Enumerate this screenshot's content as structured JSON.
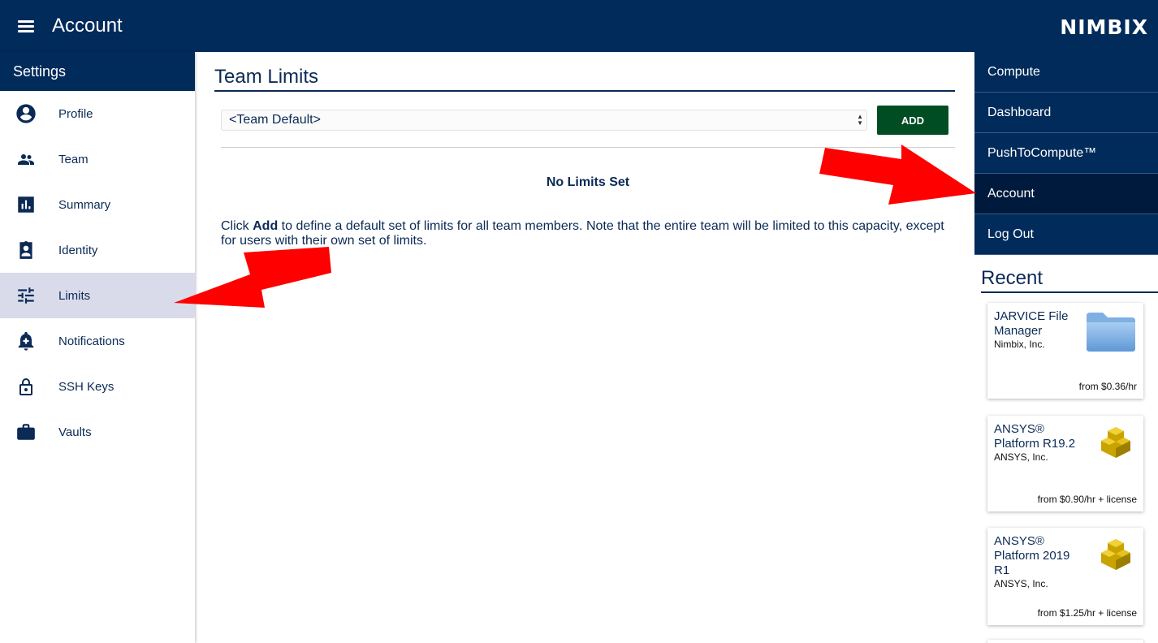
{
  "header": {
    "title": "Account",
    "logo": "NIMBIX"
  },
  "sidebar": {
    "title": "Settings",
    "items": [
      {
        "label": "Profile",
        "icon": "account-circle-icon",
        "active": false
      },
      {
        "label": "Team",
        "icon": "people-icon",
        "active": false
      },
      {
        "label": "Summary",
        "icon": "bar-chart-icon",
        "active": false
      },
      {
        "label": "Identity",
        "icon": "badge-icon",
        "active": false
      },
      {
        "label": "Limits",
        "icon": "tune-sliders-icon",
        "active": true
      },
      {
        "label": "Notifications",
        "icon": "bell-plus-icon",
        "active": false
      },
      {
        "label": "SSH Keys",
        "icon": "lock-icon",
        "active": false
      },
      {
        "label": "Vaults",
        "icon": "briefcase-icon",
        "active": false
      }
    ]
  },
  "main": {
    "title": "Team Limits",
    "select_value": "<Team Default>",
    "add_label": "ADD",
    "no_limits": "No Limits Set",
    "desc_prefix": "Click ",
    "desc_bold": "Add",
    "desc_suffix": " to define a default set of limits for all team members. Note that the entire team will be limited to this capacity, except for users with their own set of limits."
  },
  "rightnav": {
    "items": [
      {
        "label": "Compute",
        "active": false
      },
      {
        "label": "Dashboard",
        "active": false
      },
      {
        "label": "PushToCompute™",
        "active": false
      },
      {
        "label": "Account",
        "active": true
      },
      {
        "label": "Log Out",
        "active": false
      }
    ],
    "recent_title": "Recent",
    "cards": [
      {
        "name": "JARVICE File Manager",
        "vendor": "Nimbix, Inc.",
        "price": "from $0.36/hr",
        "icon": "folder-icon"
      },
      {
        "name": "ANSYS® Platform R19.2",
        "vendor": "ANSYS, Inc.",
        "price": "from $0.90/hr + license",
        "icon": "ansys-cube-icon"
      },
      {
        "name": "ANSYS® Platform 2019 R1",
        "vendor": "ANSYS, Inc.",
        "price": "from $1.25/hr + license",
        "icon": "ansys-cube-icon"
      }
    ]
  },
  "colors": {
    "brand": "#002b5a",
    "add_button": "#004d23",
    "active_sidebar": "#d9dbeb",
    "annotation_arrow": "#ff0000"
  }
}
